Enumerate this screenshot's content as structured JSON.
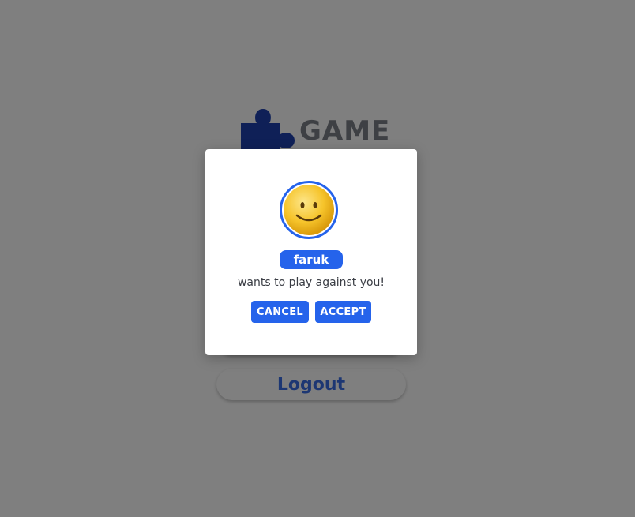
{
  "app": {
    "logo_text": "GAME",
    "buttons": [
      {
        "label": ""
      },
      {
        "label": "Logout"
      }
    ]
  },
  "invite_dialog": {
    "avatar_icon": "smiley-face-icon",
    "username": "faruk",
    "message": "wants to play against you!",
    "cancel_label": "CANCEL",
    "accept_label": "ACCEPT"
  },
  "colors": {
    "accent": "#2563eb",
    "logo_icon": "#1e40af",
    "overlay": "rgba(0,0,0,0.5)"
  }
}
